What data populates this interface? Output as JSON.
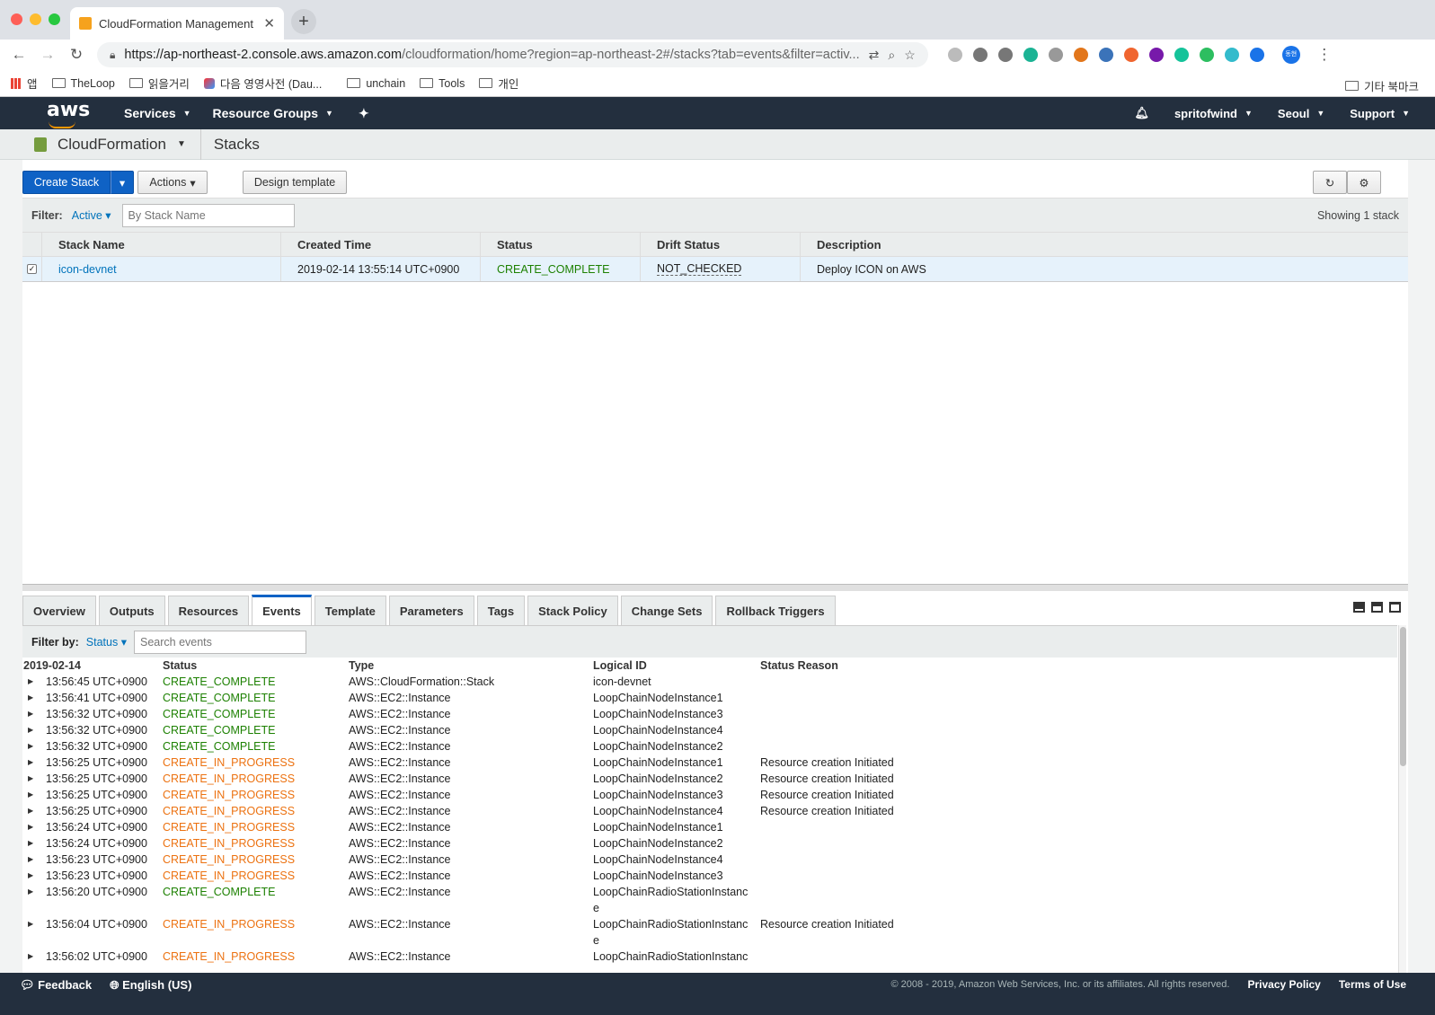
{
  "browser": {
    "tab_title": "CloudFormation Management C",
    "url_host": "https://ap-northeast-2.console.aws.amazon.com",
    "url_rest": "/cloudformation/home?region=ap-northeast-2#/stacks?tab=events&filter=activ...",
    "bookmarks": [
      "앱",
      "TheLoop",
      "읽을거리",
      "다음 영영사전 (Dau...",
      "unchain",
      "Tools",
      "개인"
    ],
    "bookmarks_other": "기타 북마크",
    "ext_colors": [
      "#bbbbbb",
      "#777777",
      "#777777",
      "#1bb394",
      "#999999",
      "#e2761b",
      "#3b73b9",
      "#f0652f",
      "#7719aa",
      "#15c39a",
      "#2dbe60",
      "#33bbcc",
      "#1a73e8"
    ],
    "profile_initials": "동현"
  },
  "awsnav": {
    "logo": "aws",
    "services": "Services",
    "resource_groups": "Resource Groups",
    "user": "spritofwind",
    "region": "Seoul",
    "support": "Support"
  },
  "service": {
    "name": "CloudFormation",
    "page": "Stacks"
  },
  "toolbar": {
    "create_stack": "Create Stack",
    "actions": "Actions",
    "design_template": "Design template"
  },
  "filter": {
    "label": "Filter:",
    "value": "Active",
    "placeholder": "By Stack Name",
    "showing": "Showing 1 stack"
  },
  "stacks": {
    "headers": [
      "Stack Name",
      "Created Time",
      "Status",
      "Drift Status",
      "Description"
    ],
    "rows": [
      {
        "name": "icon-devnet",
        "created": "2019-02-14 13:55:14 UTC+0900",
        "status": "CREATE_COMPLETE",
        "drift": "NOT_CHECKED",
        "description": "Deploy ICON on AWS"
      }
    ]
  },
  "detail_tabs": [
    "Overview",
    "Outputs",
    "Resources",
    "Events",
    "Template",
    "Parameters",
    "Tags",
    "Stack Policy",
    "Change Sets",
    "Rollback Triggers"
  ],
  "active_tab": "Events",
  "events": {
    "filter_label": "Filter by:",
    "filter_value": "Status",
    "search_placeholder": "Search events",
    "headers": [
      "2019-02-14",
      "Status",
      "Type",
      "Logical ID",
      "Status Reason"
    ],
    "rows": [
      [
        "13:56:45 UTC+0900",
        "CREATE_COMPLETE",
        "AWS::CloudFormation::Stack",
        "icon-devnet",
        ""
      ],
      [
        "13:56:41 UTC+0900",
        "CREATE_COMPLETE",
        "AWS::EC2::Instance",
        "LoopChainNodeInstance1",
        ""
      ],
      [
        "13:56:32 UTC+0900",
        "CREATE_COMPLETE",
        "AWS::EC2::Instance",
        "LoopChainNodeInstance3",
        ""
      ],
      [
        "13:56:32 UTC+0900",
        "CREATE_COMPLETE",
        "AWS::EC2::Instance",
        "LoopChainNodeInstance4",
        ""
      ],
      [
        "13:56:32 UTC+0900",
        "CREATE_COMPLETE",
        "AWS::EC2::Instance",
        "LoopChainNodeInstance2",
        ""
      ],
      [
        "13:56:25 UTC+0900",
        "CREATE_IN_PROGRESS",
        "AWS::EC2::Instance",
        "LoopChainNodeInstance1",
        "Resource creation Initiated"
      ],
      [
        "13:56:25 UTC+0900",
        "CREATE_IN_PROGRESS",
        "AWS::EC2::Instance",
        "LoopChainNodeInstance2",
        "Resource creation Initiated"
      ],
      [
        "13:56:25 UTC+0900",
        "CREATE_IN_PROGRESS",
        "AWS::EC2::Instance",
        "LoopChainNodeInstance3",
        "Resource creation Initiated"
      ],
      [
        "13:56:25 UTC+0900",
        "CREATE_IN_PROGRESS",
        "AWS::EC2::Instance",
        "LoopChainNodeInstance4",
        "Resource creation Initiated"
      ],
      [
        "13:56:24 UTC+0900",
        "CREATE_IN_PROGRESS",
        "AWS::EC2::Instance",
        "LoopChainNodeInstance1",
        ""
      ],
      [
        "13:56:24 UTC+0900",
        "CREATE_IN_PROGRESS",
        "AWS::EC2::Instance",
        "LoopChainNodeInstance2",
        ""
      ],
      [
        "13:56:23 UTC+0900",
        "CREATE_IN_PROGRESS",
        "AWS::EC2::Instance",
        "LoopChainNodeInstance4",
        ""
      ],
      [
        "13:56:23 UTC+0900",
        "CREATE_IN_PROGRESS",
        "AWS::EC2::Instance",
        "LoopChainNodeInstance3",
        ""
      ],
      [
        "13:56:20 UTC+0900",
        "CREATE_COMPLETE",
        "AWS::EC2::Instance",
        "LoopChainRadioStationInstance",
        ""
      ],
      [
        "13:56:04 UTC+0900",
        "CREATE_IN_PROGRESS",
        "AWS::EC2::Instance",
        "LoopChainRadioStationInstance",
        "Resource creation Initiated"
      ],
      [
        "13:56:02 UTC+0900",
        "CREATE_IN_PROGRESS",
        "AWS::EC2::Instance",
        "LoopChainRadioStationInstanc",
        ""
      ]
    ]
  },
  "footer": {
    "feedback": "Feedback",
    "language": "English (US)",
    "copyright": "© 2008 - 2019, Amazon Web Services, Inc. or its affiliates. All rights reserved.",
    "privacy": "Privacy Policy",
    "terms": "Terms of Use"
  },
  "colors": {
    "complete": "#1d8102",
    "in_progress": "#ec7211",
    "nav_bg": "#232f3e",
    "primary": "#0f62c5"
  }
}
